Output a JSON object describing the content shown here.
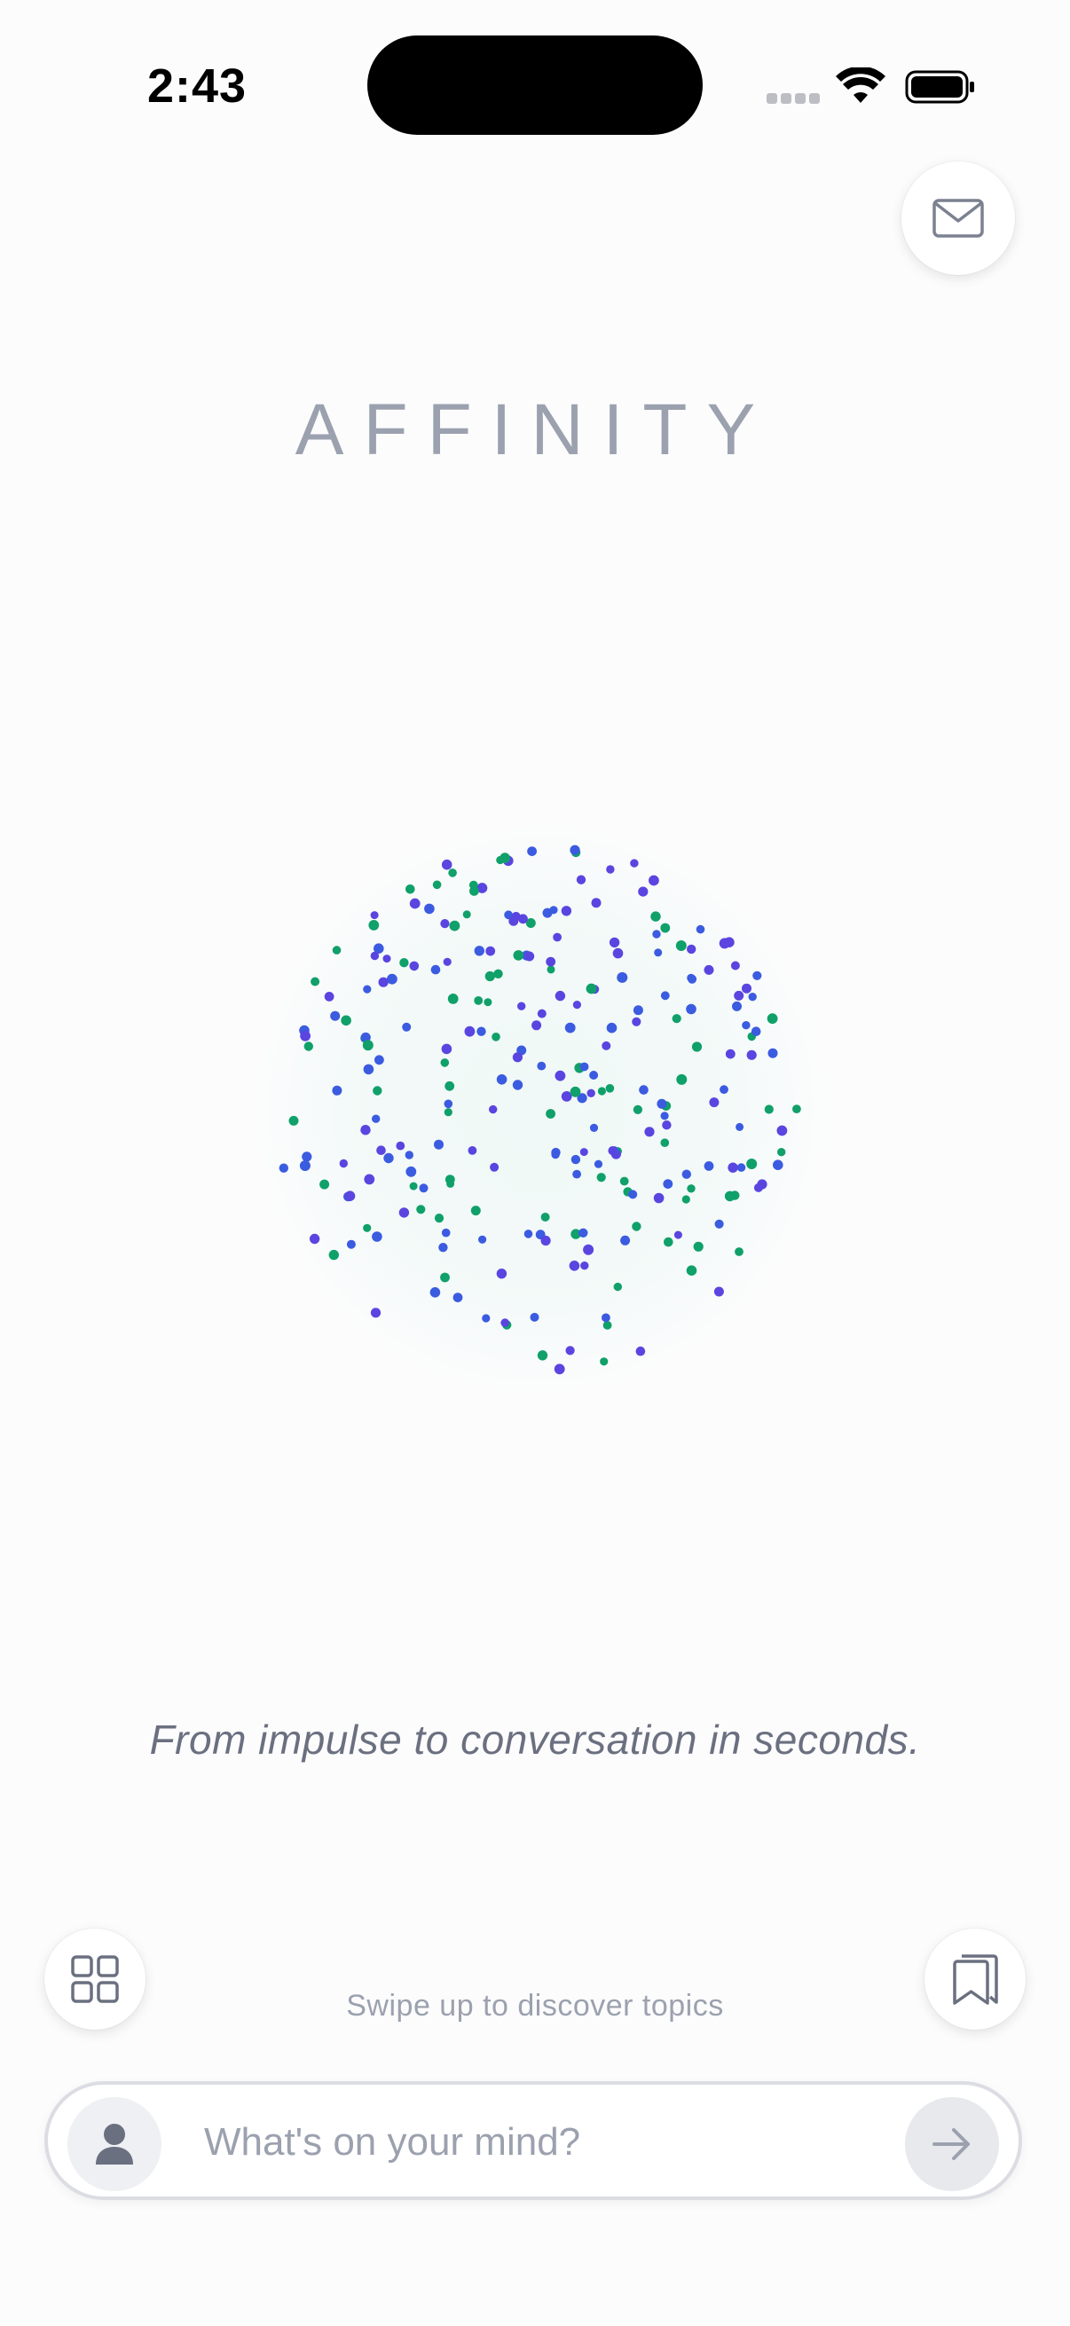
{
  "status_bar": {
    "time": "2:43"
  },
  "header": {
    "mail_icon": "envelope-icon"
  },
  "brand": {
    "title": "AFFINITY"
  },
  "orb": {
    "colors": [
      "#10a06a",
      "#3b5be0",
      "#5a45e0"
    ]
  },
  "tagline": "From impulse to conversation in seconds.",
  "bottom": {
    "grid_icon": "grid-icon",
    "bookmark_icon": "bookmarks-icon",
    "swipe_hint": "Swipe up to discover topics"
  },
  "composer": {
    "placeholder": "What's on your mind?",
    "avatar_icon": "person-icon",
    "send_icon": "arrow-right-icon"
  }
}
